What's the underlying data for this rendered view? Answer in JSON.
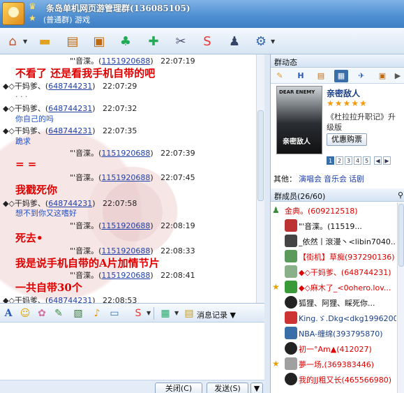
{
  "window": {
    "title": "条岛单机网页游管理群(136085105)",
    "subtitle": "(普通群) 游戏"
  },
  "toolbar": {
    "icons": [
      "home-icon",
      "folder-icon",
      "album-icon",
      "window-icon",
      "members-icon",
      "add-icon",
      "tools-icon",
      "sogou-icon",
      "person-icon",
      "settings-icon"
    ]
  },
  "chat": {
    "messages": [
      {
        "type": "sys",
        "prefix": "\"'音渫。",
        "id": "1151920688",
        "time": "22:07:19"
      },
      {
        "type": "big",
        "text": "不看了  还是看我手机自带的吧"
      },
      {
        "type": "sys",
        "prefix": "◆◇干妈爹、",
        "id": "648744231",
        "time": "22:07:29"
      },
      {
        "type": "dots",
        "text": ". . ."
      },
      {
        "type": "sys",
        "prefix": "◆◇干妈爹、",
        "id": "648744231",
        "time": "22:07:32"
      },
      {
        "type": "blue",
        "text": "你自己的吗"
      },
      {
        "type": "sys",
        "prefix": "◆◇干妈爹、",
        "id": "648744231",
        "time": "22:07:35"
      },
      {
        "type": "blue",
        "text": "跪求"
      },
      {
        "type": "sys",
        "prefix": "\"'音渫。",
        "id": "1151920688",
        "time": "22:07:39"
      },
      {
        "type": "big",
        "text": "=  ="
      },
      {
        "type": "sys",
        "prefix": "\"'音渫。",
        "id": "1151920688",
        "time": "22:07:45"
      },
      {
        "type": "big",
        "text": "我戳死你"
      },
      {
        "type": "sys",
        "prefix": "◆◇干妈爹、",
        "id": "648744231",
        "time": "22:07:58"
      },
      {
        "type": "blue",
        "text": "想不到你又这嗜好"
      },
      {
        "type": "sys",
        "prefix": "\"'音渫。",
        "id": "1151920688",
        "time": "22:08:19"
      },
      {
        "type": "big",
        "text": "死去•"
      },
      {
        "type": "sys",
        "prefix": "\"'音渫。",
        "id": "1151920688",
        "time": "22:08:33"
      },
      {
        "type": "big",
        "text": "我是说手机自带的A片加情节片"
      },
      {
        "type": "sys",
        "prefix": "\"'音渫。",
        "id": "1151920688",
        "time": "22:08:41"
      },
      {
        "type": "big",
        "text": "一共自带30个"
      },
      {
        "type": "sys",
        "prefix": "◆◇干妈爹、",
        "id": "648744231",
        "time": "22:08:53"
      }
    ]
  },
  "input_toolbar": {
    "record_label": "消息记录"
  },
  "buttons": {
    "close": "关闭(C)",
    "send": "发送(S)"
  },
  "group_news": {
    "header": "群动态",
    "movie_title": "亲密敌人",
    "stars": "★★★★★",
    "description": "《杜拉拉升职记》升级版",
    "buy_label": "优惠购票",
    "pages": [
      "1",
      "2",
      "3",
      "4",
      "5"
    ],
    "others_label": "其他：",
    "others_links": [
      "演唱会",
      "音乐会",
      "话剧"
    ]
  },
  "members": {
    "header": "群成员(26/60)",
    "list": [
      {
        "name": "金典。(609212518)",
        "color": "red"
      },
      {
        "name": "\"'音渫。(11519...",
        "color": "black"
      },
      {
        "name": "_依然丨滾漫丶<libin7040...",
        "color": "black"
      },
      {
        "name": "【街机】草痴(937290136)",
        "color": "red"
      },
      {
        "name": "◆◇干妈爹、(648744231)",
        "color": "red"
      },
      {
        "name": "◆◇麻木了_<0ohero.lov...",
        "color": "red"
      },
      {
        "name": "狐狸、阿狸、睬死你...",
        "color": "black"
      },
      {
        "name": "King.ゞ.Dkg<dkg19962008...",
        "color": "blue"
      },
      {
        "name": "NBA-缠绵(393795870)",
        "color": "blue"
      },
      {
        "name": "初一°Am▲(412027)",
        "color": "red"
      },
      {
        "name": "夢一场,(369383446)",
        "color": "red"
      },
      {
        "name": "我的JJ粗又长(465566980)",
        "color": "red"
      }
    ]
  }
}
